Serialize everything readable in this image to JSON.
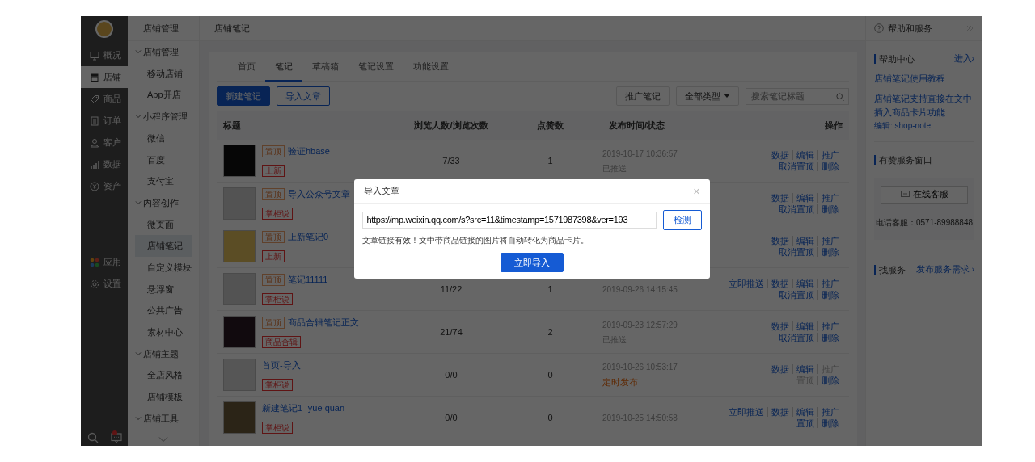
{
  "nav_primary": {
    "main_items": [
      {
        "label": "概况",
        "selected": false
      },
      {
        "label": "店铺",
        "selected": true
      },
      {
        "label": "商品",
        "selected": false
      },
      {
        "label": "订单",
        "selected": false
      },
      {
        "label": "客户",
        "selected": false
      },
      {
        "label": "数据",
        "selected": false
      },
      {
        "label": "资产",
        "selected": false
      }
    ],
    "extra_items": [
      {
        "label": "应用",
        "selected": false
      },
      {
        "label": "设置",
        "selected": false
      }
    ],
    "chat_unread": true
  },
  "nav_secondary": {
    "title": "店铺管理",
    "groups": [
      {
        "label": "店铺管理",
        "expanded": true,
        "children": [
          {
            "label": "移动店铺",
            "selected": false
          },
          {
            "label": "App开店",
            "selected": false
          }
        ]
      },
      {
        "label": "小程序管理",
        "expanded": true,
        "children": [
          {
            "label": "微信",
            "selected": false
          },
          {
            "label": "百度",
            "selected": false
          },
          {
            "label": "支付宝",
            "selected": false
          }
        ]
      },
      {
        "label": "内容创作",
        "expanded": true,
        "children": [
          {
            "label": "微页面",
            "selected": false
          },
          {
            "label": "店铺笔记",
            "selected": true
          },
          {
            "label": "自定义模块",
            "selected": false
          },
          {
            "label": "悬浮窗",
            "selected": false
          },
          {
            "label": "公共广告",
            "selected": false
          },
          {
            "label": "素材中心",
            "selected": false
          }
        ]
      },
      {
        "label": "店铺主题",
        "expanded": true,
        "children": [
          {
            "label": "全店风格",
            "selected": false
          },
          {
            "label": "店铺模板",
            "selected": false
          }
        ]
      },
      {
        "label": "店铺工具",
        "expanded": true
      }
    ]
  },
  "breadcrumb": "店铺笔记",
  "tabs": [
    {
      "label": "首页",
      "selected": false
    },
    {
      "label": "笔记",
      "selected": true
    },
    {
      "label": "草稿箱",
      "selected": false
    },
    {
      "label": "笔记设置",
      "selected": false
    },
    {
      "label": "功能设置",
      "selected": false
    }
  ],
  "toolbar": {
    "new_button": "新建笔记",
    "import_button": "导入文章",
    "promote_button": "推广笔记",
    "type_filter": "全部类型",
    "search": {
      "placeholder": "搜索笔记标题"
    }
  },
  "table": {
    "columns": [
      "标题",
      "浏览人数/浏览次数",
      "点赞数",
      "发布时间/状态",
      "操作"
    ],
    "rows": [
      {
        "pin": "置顶",
        "title": "验证hbase",
        "tag": "上新",
        "views": "7/33",
        "likes": "1",
        "time": "2019-10-17 10:36:57",
        "status": {
          "text": "已推送",
          "kind": "pushed"
        },
        "actions": [
          [
            {
              "label": "数据",
              "disabled": false
            },
            {
              "label": "编辑",
              "disabled": false
            },
            {
              "label": "推广",
              "disabled": false
            }
          ],
          [
            {
              "label": "取消置顶",
              "disabled": false
            },
            {
              "label": "删除",
              "disabled": false
            }
          ]
        ]
      },
      {
        "pin": "置顶",
        "title": "导入公众号文章",
        "tag": "掌柜说",
        "actions": [
          [
            {
              "label": "数据",
              "disabled": false
            },
            {
              "label": "编辑",
              "disabled": false
            },
            {
              "label": "推广",
              "disabled": false
            }
          ],
          [
            {
              "label": "取消置顶",
              "disabled": false
            },
            {
              "label": "删除",
              "disabled": false
            }
          ]
        ]
      },
      {
        "pin": "置顶",
        "title": "上新笔记0",
        "tag": "上新",
        "actions": [
          [
            {
              "label": "数据",
              "disabled": false
            },
            {
              "label": "编辑",
              "disabled": false
            },
            {
              "label": "推广",
              "disabled": false
            }
          ],
          [
            {
              "label": "取消置顶",
              "disabled": false
            },
            {
              "label": "删除",
              "disabled": false
            }
          ]
        ]
      },
      {
        "pin": "置顶",
        "title": "笔记11111",
        "tag": "掌柜说",
        "views": "11/22",
        "likes": "1",
        "time": "2019-09-26 14:15:45",
        "actions": [
          [
            {
              "label": "立即推送",
              "disabled": false
            },
            {
              "label": "数据",
              "disabled": false
            },
            {
              "label": "编辑",
              "disabled": false
            },
            {
              "label": "推广",
              "disabled": false
            }
          ],
          [
            {
              "label": "取消置顶",
              "disabled": false
            },
            {
              "label": "删除",
              "disabled": false
            }
          ]
        ]
      },
      {
        "pin": "置顶",
        "title": "商品合辑笔记正文",
        "tag": "商品合辑",
        "views": "21/74",
        "likes": "2",
        "time": "2019-09-23 12:57:29",
        "status": {
          "text": "已推送",
          "kind": "pushed"
        },
        "actions": [
          [
            {
              "label": "数据",
              "disabled": false
            },
            {
              "label": "编辑",
              "disabled": false
            },
            {
              "label": "推广",
              "disabled": false
            }
          ],
          [
            {
              "label": "取消置顶",
              "disabled": false
            },
            {
              "label": "删除",
              "disabled": false
            }
          ]
        ]
      },
      {
        "title": "首页-导入",
        "tag": "掌柜说",
        "views": "0/0",
        "likes": "0",
        "time": "2019-10-26 10:53:17",
        "status": {
          "text": "定时发布",
          "kind": "scheduled"
        },
        "actions": [
          [
            {
              "label": "数据",
              "disabled": false
            },
            {
              "label": "编辑",
              "disabled": false
            },
            {
              "label": "推广",
              "disabled": true
            }
          ],
          [
            {
              "label": "置顶",
              "disabled": true
            },
            {
              "label": "删除",
              "disabled": false
            }
          ]
        ]
      },
      {
        "title": "新建笔记1- yue quan",
        "tag": "掌柜说",
        "views": "0/0",
        "likes": "0",
        "time": "2019-10-25 14:50:58",
        "actions": [
          [
            {
              "label": "立即推送",
              "disabled": false
            },
            {
              "label": "数据",
              "disabled": false
            },
            {
              "label": "编辑",
              "disabled": false
            },
            {
              "label": "推广",
              "disabled": false
            }
          ],
          [
            {
              "label": "置顶",
              "disabled": false
            },
            {
              "label": "删除",
              "disabled": false
            }
          ]
        ]
      }
    ]
  },
  "help_panel": {
    "title": "帮助和服务",
    "help_center": {
      "heading": "帮助中心",
      "enter_link": "进入›",
      "links": [
        "店铺笔记使用教程",
        "店铺笔记支持直接在文中插入商品卡片功能"
      ],
      "editor": "编辑: shop-note"
    },
    "service": {
      "heading": "有赞服务窗口",
      "chat_button": "在线客服",
      "phone": "电话客服：0571-89988848"
    },
    "find": {
      "heading": "找服务",
      "link": "发布服务需求 ›"
    }
  },
  "modal": {
    "title": "导入文章",
    "close": "×",
    "url_value": "https://mp.weixin.qq.com/s?src=11&timestamp=1571987398&ver=193",
    "check_button": "检测",
    "hint": "文章链接有效！文中带商品链接的图片将自动转化为商品卡片。",
    "import_button": "立即导入"
  }
}
